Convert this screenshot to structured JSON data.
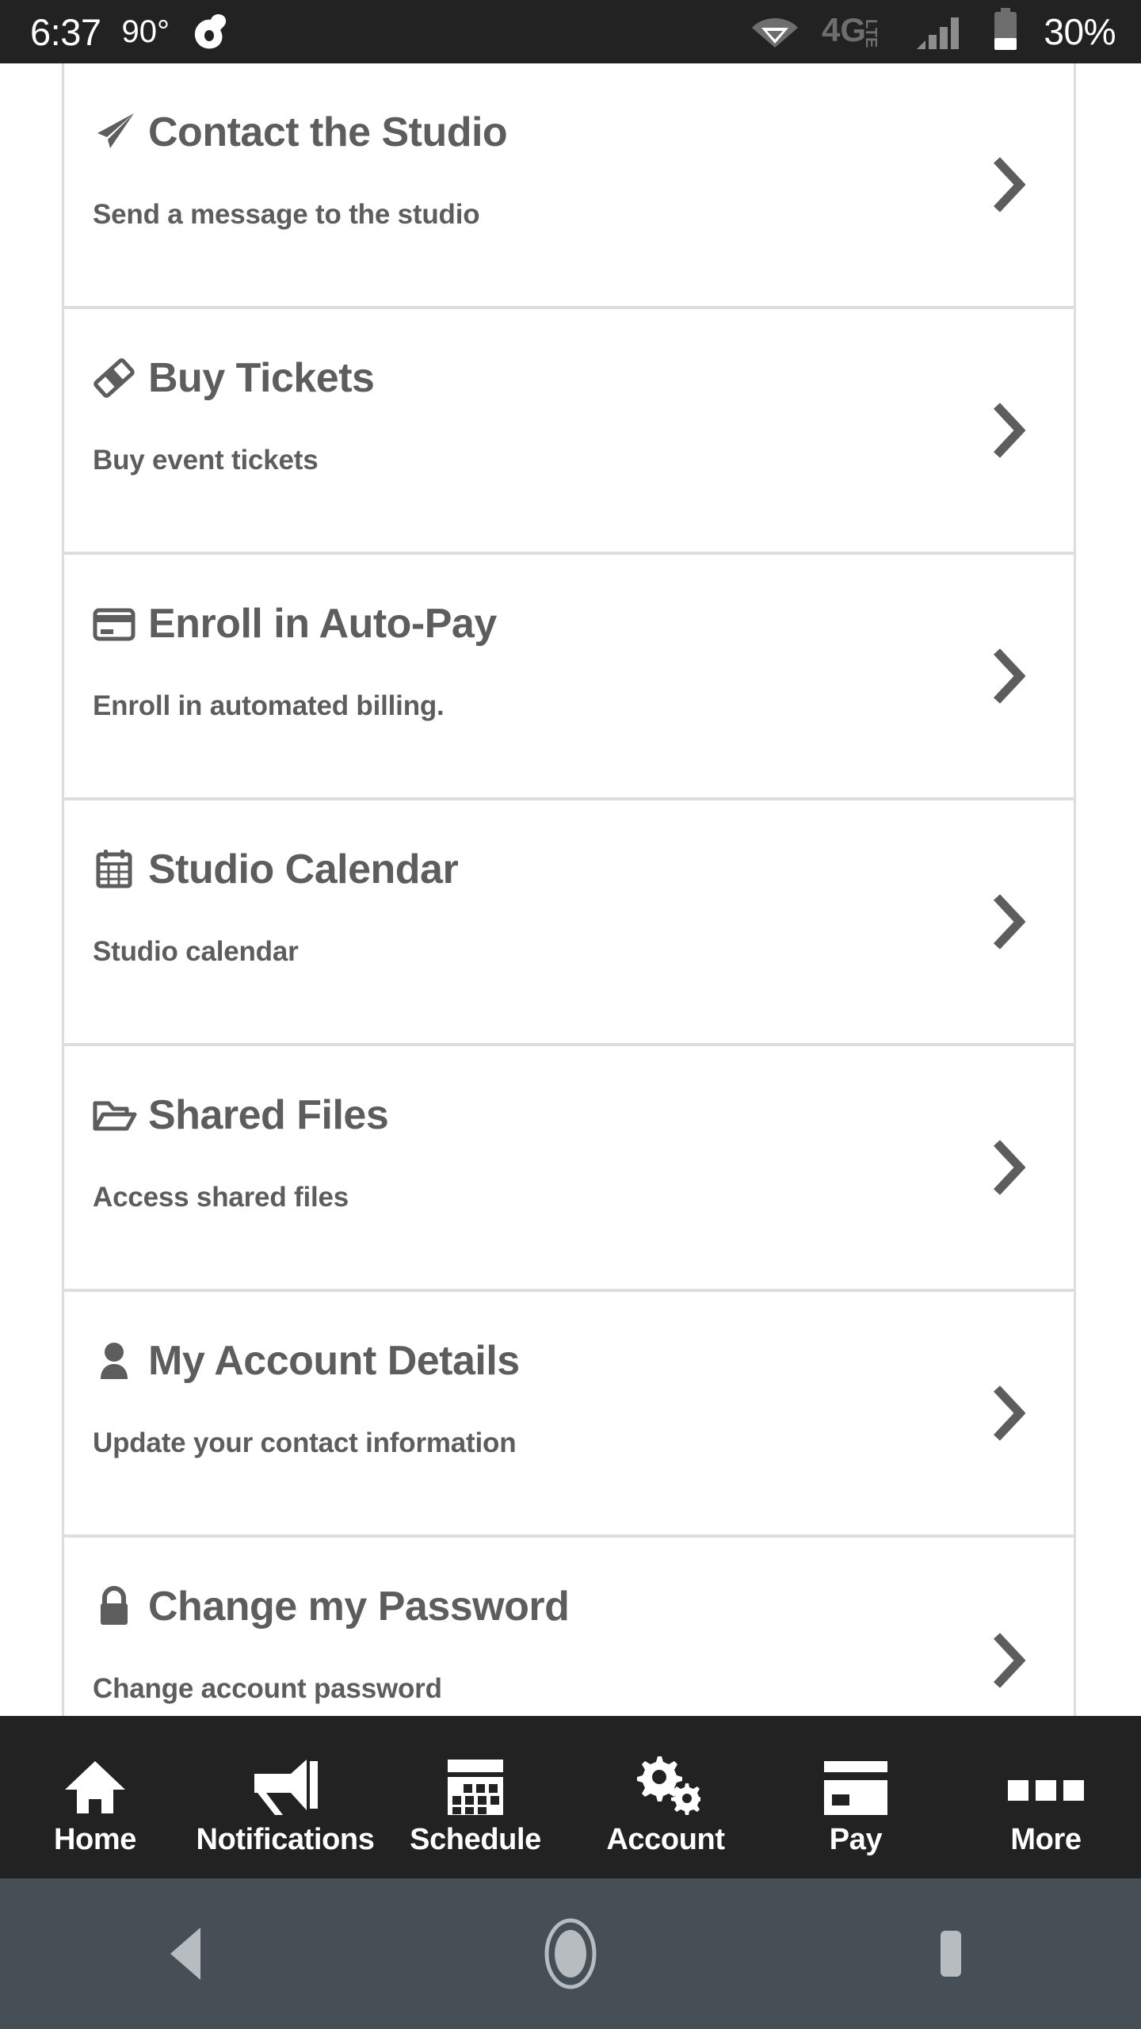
{
  "status_bar": {
    "time": "6:37",
    "temperature": "90°",
    "app_icon": "avast-icon",
    "wifi_icon": "wifi-icon",
    "network_type": "4G",
    "network_suffix": "LTE",
    "signal_icon": "cellular-signal-icon",
    "battery_icon": "battery-icon",
    "battery_percent": "30%",
    "background_color": "#222222",
    "text_color": "#ffffff"
  },
  "menu": {
    "items": [
      {
        "icon": "paper-plane-icon",
        "title": "Contact the Studio",
        "subtitle": "Send a message to the studio",
        "chevron": "chevron-right-icon"
      },
      {
        "icon": "ticket-icon",
        "title": "Buy Tickets",
        "subtitle": "Buy event tickets",
        "chevron": "chevron-right-icon"
      },
      {
        "icon": "credit-card-icon",
        "title": "Enroll in Auto-Pay",
        "subtitle": "Enroll in automated billing.",
        "chevron": "chevron-right-icon"
      },
      {
        "icon": "calendar-icon",
        "title": "Studio Calendar",
        "subtitle": "Studio calendar",
        "chevron": "chevron-right-icon"
      },
      {
        "icon": "folder-open-icon",
        "title": "Shared Files",
        "subtitle": "Access shared files",
        "chevron": "chevron-right-icon"
      },
      {
        "icon": "user-icon",
        "title": "My Account Details",
        "subtitle": "Update your contact information",
        "chevron": "chevron-right-icon"
      },
      {
        "icon": "lock-icon",
        "title": "Change my Password",
        "subtitle": "Change account password",
        "chevron": "chevron-right-icon"
      }
    ],
    "text_color": "#5d5d5d",
    "divider_color": "#dddddd",
    "background_color": "#ffffff"
  },
  "tab_bar": {
    "background_color": "#222222",
    "text_color": "#ffffff",
    "tabs": [
      {
        "icon": "home-icon",
        "label": "Home"
      },
      {
        "icon": "bullhorn-icon",
        "label": "Notifications"
      },
      {
        "icon": "calendar-filled-icon",
        "label": "Schedule"
      },
      {
        "icon": "cogs-icon",
        "label": "Account"
      },
      {
        "icon": "credit-card-filled-icon",
        "label": "Pay"
      },
      {
        "icon": "ellipsis-squares-icon",
        "label": "More"
      }
    ]
  },
  "android_nav": {
    "background_color": "#474f56",
    "icon_color": "#b6bcbf",
    "buttons": [
      {
        "icon": "back-triangle-icon",
        "name": "back"
      },
      {
        "icon": "home-circle-icon",
        "name": "home"
      },
      {
        "icon": "recents-square-icon",
        "name": "recents"
      }
    ]
  }
}
